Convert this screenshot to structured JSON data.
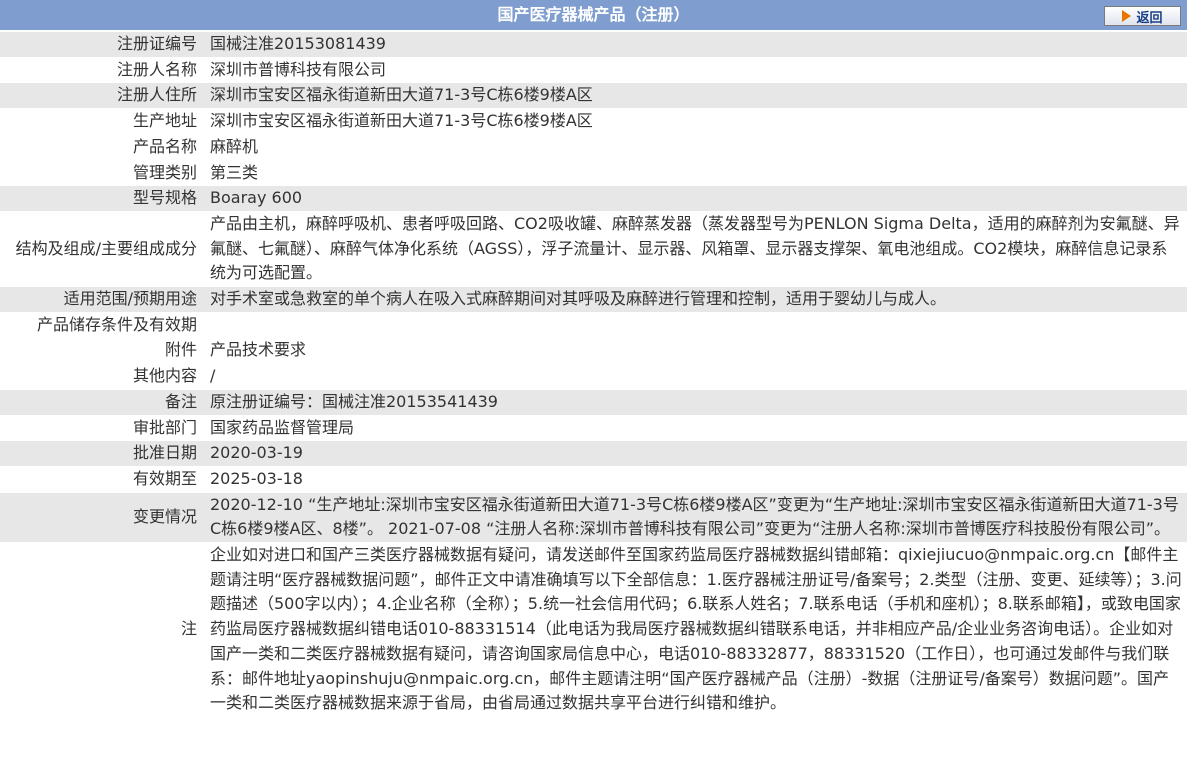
{
  "header": {
    "title": "国产医疗器械产品（注册）",
    "back_label": "返回"
  },
  "rows": [
    {
      "label": "注册证编号",
      "value": "国械注准20153081439"
    },
    {
      "label": "注册人名称",
      "value": "深圳市普博科技有限公司"
    },
    {
      "label": "注册人住所",
      "value": "深圳市宝安区福永街道新田大道71-3号C栋6楼9楼A区"
    },
    {
      "label": "生产地址",
      "value": "深圳市宝安区福永街道新田大道71-3号C栋6楼9楼A区"
    },
    {
      "label": "产品名称",
      "value": "麻醉机"
    },
    {
      "label": "管理类别",
      "value": "第三类"
    },
    {
      "label": "型号规格",
      "value": "Boaray 600"
    },
    {
      "label": "结构及组成/主要组成成分",
      "value": "产品由主机，麻醉呼吸机、患者呼吸回路、CO2吸收罐、麻醉蒸发器（蒸发器型号为PENLON Sigma Delta，适用的麻醉剂为安氟醚、异氟醚、七氟醚）、麻醉气体净化系统（AGSS），浮子流量计、显示器、风箱罩、显示器支撑架、氧电池组成。CO2模块，麻醉信息记录系统为可选配置。"
    },
    {
      "label": "适用范围/预期用途",
      "value": "对手术室或急救室的单个病人在吸入式麻醉期间对其呼吸及麻醉进行管理和控制，适用于婴幼儿与成人。"
    },
    {
      "label": "产品储存条件及有效期",
      "value": ""
    },
    {
      "label": "附件",
      "value": "产品技术要求"
    },
    {
      "label": "其他内容",
      "value": "/"
    },
    {
      "label": "备注",
      "value": "原注册证编号：国械注准20153541439"
    },
    {
      "label": "审批部门",
      "value": "国家药品监督管理局"
    },
    {
      "label": "批准日期",
      "value": "2020-03-19"
    },
    {
      "label": "有效期至",
      "value": "2025-03-18"
    },
    {
      "label": "变更情况",
      "value": "2020-12-10 “生产地址:深圳市宝安区福永街道新田大道71-3号C栋6楼9楼A区”变更为“生产地址:深圳市宝安区福永街道新田大道71-3号C栋6楼9楼A区、8楼”。 2021-07-08 “注册人名称:深圳市普博科技有限公司”变更为“注册人名称:深圳市普博医疗科技股份有限公司”。"
    },
    {
      "label": "注",
      "value": "企业如对进口和国产三类医疗器械数据有疑问，请发送邮件至国家药监局医疗器械数据纠错邮箱：qixiejiucuo@nmpaic.org.cn【邮件主题请注明“医疗器械数据问题”，邮件正文中请准确填写以下全部信息：1.医疗器械注册证号/备案号；2.类型（注册、变更、延续等）；3.问题描述（500字以内）；4.企业名称（全称）；5.统一社会信用代码；6.联系人姓名；7.联系电话（手机和座机）；8.联系邮箱】，或致电国家药监局医疗器械数据纠错电话010-88331514（此电话为我局医疗器械数据纠错联系电话，并非相应产品/企业业务咨询电话）。企业如对国产一类和二类医疗器械数据有疑问，请咨询国家局信息中心，电话010-88332877，88331520（工作日），也可通过发邮件与我们联系：邮件地址yaopinshuju@nmpaic.org.cn，邮件主题请注明“国产医疗器械产品（注册）-数据（注册证号/备案号）数据问题”。国产一类和二类医疗器械数据来源于省局，由省局通过数据共享平台进行纠错和维护。"
    }
  ]
}
